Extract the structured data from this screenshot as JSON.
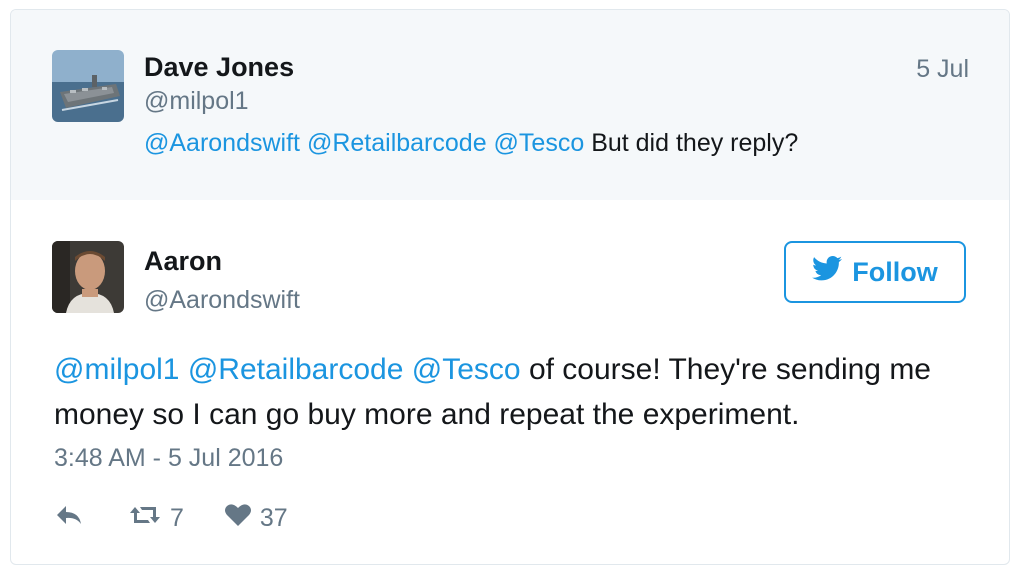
{
  "parent_tweet": {
    "author_name": "Dave Jones",
    "author_handle": "@milpol1",
    "date": "5 Jul",
    "mentions": [
      "@Aarondswift",
      "@Retailbarcode",
      "@Tesco"
    ],
    "text": "But did they reply?"
  },
  "main_tweet": {
    "author_name": "Aaron",
    "author_handle": "@Aarondswift",
    "follow_label": "Follow",
    "mentions": [
      "@milpol1",
      "@Retailbarcode",
      "@Tesco"
    ],
    "text": "of course! They're sending me money so I can go buy more and repeat the experiment.",
    "timestamp": "3:48 AM - 5 Jul 2016",
    "retweet_count": "7",
    "like_count": "37"
  },
  "colors": {
    "link_blue": "#1b95e0",
    "muted_gray": "#657786",
    "parent_background": "#f5f8fa"
  },
  "icons": {
    "parent_avatar": "aircraft-carrier-avatar",
    "main_avatar": "profile-photo-avatar",
    "follow": "twitter-bird-icon",
    "reply": "reply-icon",
    "retweet": "retweet-icon",
    "like": "heart-icon"
  }
}
